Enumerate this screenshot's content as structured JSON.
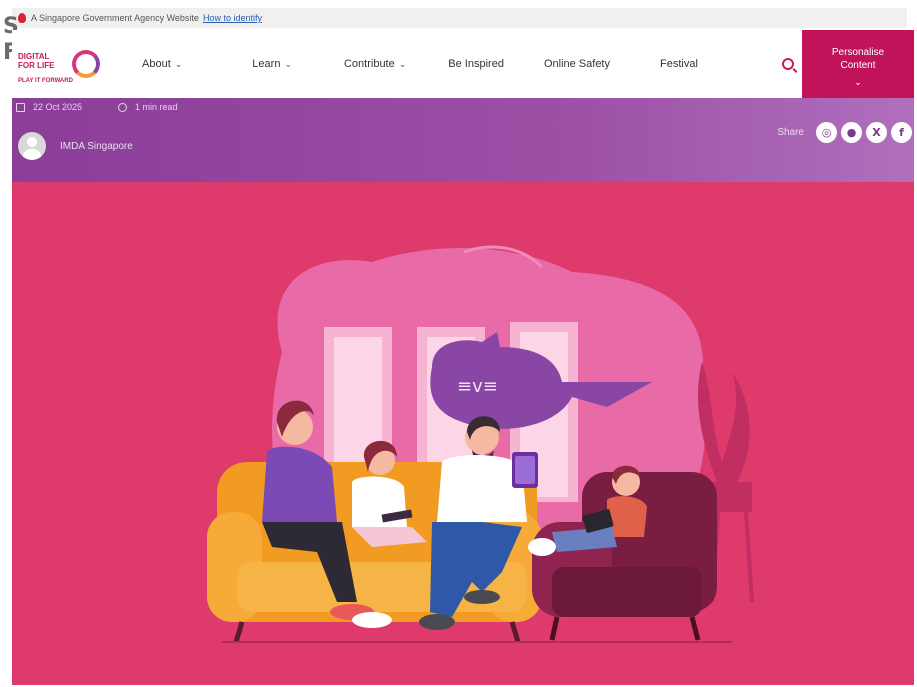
{
  "masthead": {
    "text": "A Singapore Government Agency Website",
    "link": "How to identify"
  },
  "ghost": {
    "line1": "S",
    "line2": "F"
  },
  "logo": {
    "line1": "DIGITAL",
    "line2": "FOR LIFE",
    "tagline": "PLAY IT FORWARD"
  },
  "nav": [
    {
      "label": "About",
      "dropdown": true
    },
    {
      "label": "Learn",
      "dropdown": true
    },
    {
      "label": "Contribute",
      "dropdown": true
    },
    {
      "label": "Be Inspired",
      "dropdown": false
    },
    {
      "label": "Online Safety",
      "dropdown": false
    },
    {
      "label": "Festival",
      "dropdown": false
    }
  ],
  "personalise": {
    "line1": "Personalise",
    "line2": "Content"
  },
  "article": {
    "date": "22 Oct 2025",
    "read_time": "1 min read",
    "author": "IMDA Singapore",
    "share_label": "Share"
  },
  "social": [
    {
      "icon": "whatsapp-icon",
      "glyph": "◎"
    },
    {
      "icon": "telegram-icon",
      "glyph": "●"
    },
    {
      "icon": "x-icon",
      "glyph": "X"
    },
    {
      "icon": "facebook-icon",
      "glyph": "f"
    }
  ],
  "colors": {
    "brand": "#c0135a",
    "banner": "#8b3d98",
    "hero_bg": "#de3a6c"
  }
}
